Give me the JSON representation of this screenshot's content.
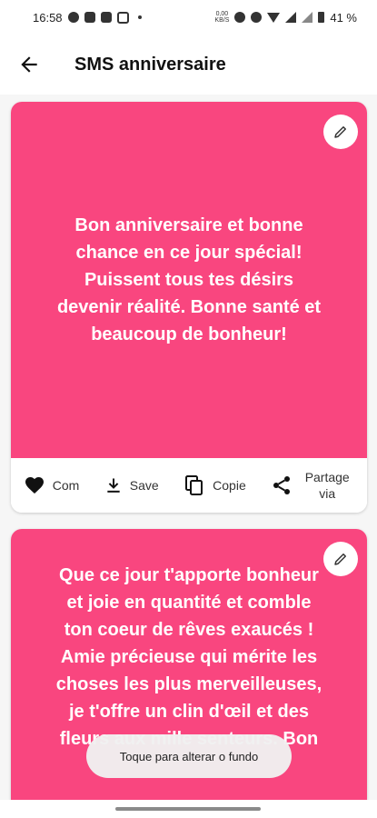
{
  "status_bar": {
    "time": "16:58",
    "data_speed_top": "0,00",
    "data_speed_bottom": "KB/S",
    "battery": "41 %"
  },
  "app_bar": {
    "title": "SMS anniversaire",
    "back_icon": "arrow-left-icon"
  },
  "cards": [
    {
      "message": "Bon anniversaire et bonne chance en ce jour spécial! Puissent tous tes désirs devenir réalité. Bonne santé et beaucoup de bonheur!",
      "background_color": "#f9467f",
      "actions": {
        "like_label": "Com",
        "save_label": "Save",
        "copy_label": "Copie",
        "share_label": "Partage via"
      }
    },
    {
      "message": "Que ce jour t'apporte bonheur et joie en quantité et comble ton coeur de rêves exaucés ! Amie précieuse qui mérite les choses les plus merveilleuses, je t'offre un clin d'œil et des fleurs aux mille senteurs. Bon",
      "background_color": "#f9467f"
    }
  ],
  "toast": {
    "text": "Toque para alterar o fundo"
  },
  "colors": {
    "accent": "#f9467f",
    "text_on_accent": "#ffffff"
  }
}
